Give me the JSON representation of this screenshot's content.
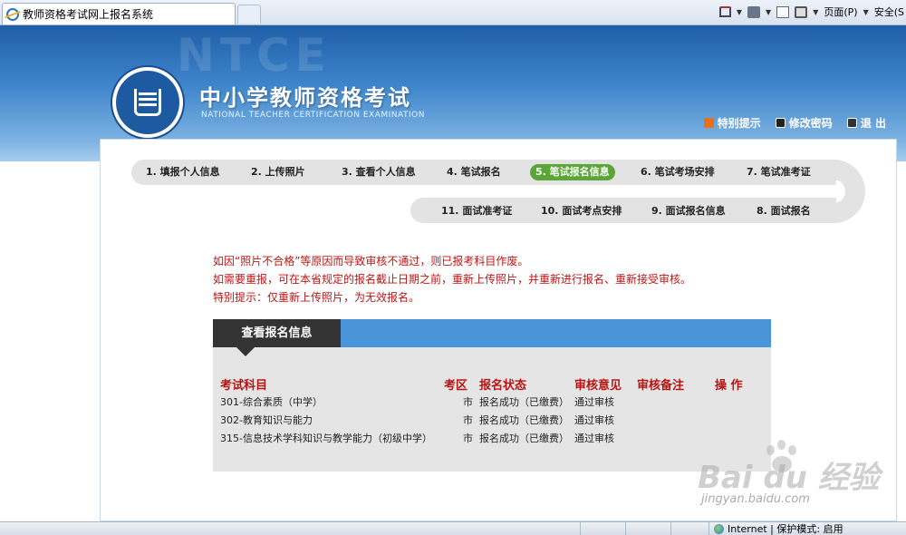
{
  "browser": {
    "tab_title": "教师资格考试网上报名系统",
    "menu_page": "页面(P)",
    "menu_safety": "安全(S"
  },
  "header": {
    "watermark": "NTCE",
    "title": "中小学教师资格考试",
    "subtitle": "NATIONAL TEACHER CERTIFICATION EXAMINATION",
    "links": {
      "help": "特别提示",
      "change_password": "修改密码",
      "logout": "退 出"
    }
  },
  "steps": {
    "s1": "1. 填报个人信息",
    "s2": "2. 上传照片",
    "s3": "3. 查看个人信息",
    "s4": "4. 笔试报名",
    "s5": "5. 笔试报名信息",
    "s6": "6. 笔试考场安排",
    "s7": "7. 笔试准考证",
    "s8": "8. 面试报名",
    "s9": "9. 面试报名信息",
    "s10": "10. 面试考点安排",
    "s11": "11. 面试准考证",
    "active": "s5"
  },
  "notice": {
    "line1": "如因“照片不合格”等原因而导致审核不通过，则已报考科目作废。",
    "line2": "如需要重报，可在本省规定的报名截止日期之前，重新上传照片，并重新进行报名、重新接受审核。",
    "line3": "特别提示：仅重新上传照片，为无效报名。"
  },
  "panel": {
    "title": "查看报名信息",
    "headers": {
      "subject": "考试科目",
      "district": "考区",
      "status": "报名状态",
      "review": "审核意见",
      "remark": "审核备注",
      "action": "操 作"
    },
    "rows": [
      {
        "subject": "301-综合素质（中学）",
        "district": "市",
        "status": "报名成功（已缴费）",
        "review": "通过审核"
      },
      {
        "subject": "302-教育知识与能力",
        "district": "市",
        "status": "报名成功（已缴费）",
        "review": "通过审核"
      },
      {
        "subject": "315-信息技术学科知识与教学能力（初级中学）",
        "district": "市",
        "status": "报名成功（已缴费）",
        "review": "通过审核"
      }
    ]
  },
  "watermark": {
    "brand": "Bai du 经验",
    "url": "jingyan.baidu.com"
  },
  "statusbar": {
    "zone": "Internet | 保护模式: 启用"
  },
  "colors": {
    "banner": "#3f86cc",
    "active_step": "#5aa637",
    "notice_text": "#c01515",
    "panel_header": "#4a94d8",
    "panel_tab": "#333333"
  }
}
